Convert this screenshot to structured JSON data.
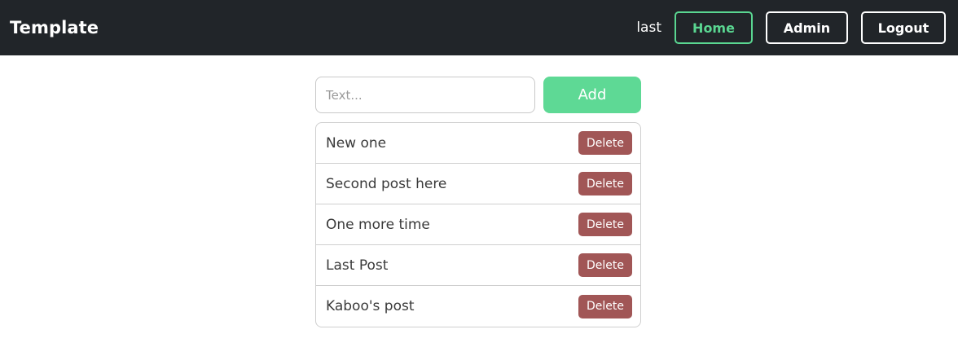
{
  "header": {
    "brand": "Template",
    "username": "last",
    "nav": {
      "home_label": "Home",
      "admin_label": "Admin",
      "logout_label": "Logout"
    }
  },
  "composer": {
    "placeholder": "Text...",
    "value": "",
    "add_label": "Add"
  },
  "posts": [
    {
      "text": "New one",
      "delete_label": "Delete"
    },
    {
      "text": "Second post here",
      "delete_label": "Delete"
    },
    {
      "text": "One more time",
      "delete_label": "Delete"
    },
    {
      "text": "Last Post",
      "delete_label": "Delete"
    },
    {
      "text": "Kaboo's post",
      "delete_label": "Delete"
    }
  ],
  "colors": {
    "navbar_bg": "#212529",
    "home_accent": "#5ad691",
    "add_button": "#5ed995",
    "delete_button": "#a15656"
  }
}
